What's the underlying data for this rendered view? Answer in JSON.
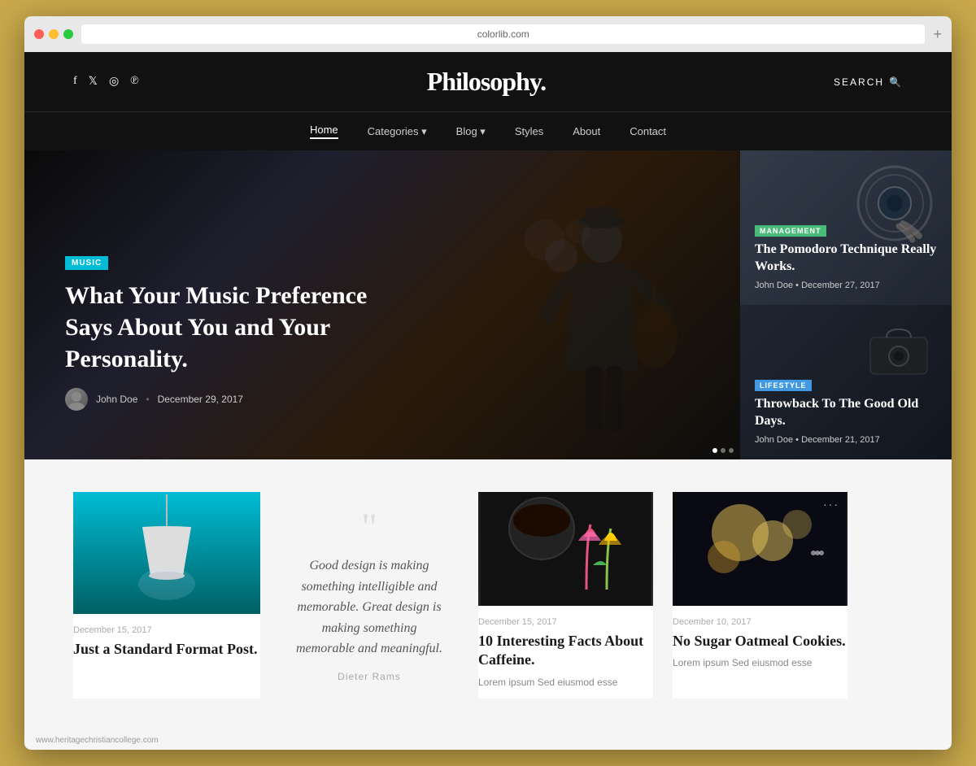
{
  "browser": {
    "url": "colorlib.com",
    "plus_button": "+"
  },
  "header": {
    "logo": "Philosophy.",
    "search_label": "SEARCH",
    "social": [
      "f",
      "𝕏",
      "◉",
      "℗"
    ]
  },
  "nav": {
    "items": [
      {
        "label": "Home",
        "active": true
      },
      {
        "label": "Categories",
        "has_dropdown": true
      },
      {
        "label": "Blog",
        "has_dropdown": true
      },
      {
        "label": "Styles",
        "has_dropdown": false
      },
      {
        "label": "About",
        "has_dropdown": false
      },
      {
        "label": "Contact",
        "has_dropdown": false
      }
    ]
  },
  "hero": {
    "tag": "MUSIC",
    "title": "What Your Music Preference Says About You and Your Personality.",
    "author": "John Doe",
    "date": "December 29, 2017"
  },
  "sidebar_cards": [
    {
      "tag": "MANAGEMENT",
      "tag_color": "green",
      "title": "The Pomodoro Technique Really Works.",
      "author": "John Doe",
      "date": "December 27, 2017"
    },
    {
      "tag": "LIFESTYLE",
      "tag_color": "teal",
      "title": "Throwback To The Good Old Days.",
      "author": "John Doe",
      "date": "December 21, 2017"
    }
  ],
  "posts": [
    {
      "type": "lamp",
      "date": "December 15, 2017",
      "title": "Just a Standard Format Post.",
      "excerpt": ""
    },
    {
      "type": "quote",
      "quote": "Good design is making something intelligible and memorable. Great design is making something memorable and meaningful.",
      "author": "Dieter Rams"
    },
    {
      "type": "coffee",
      "date": "December 15, 2017",
      "title": "10 Interesting Facts About Caffeine.",
      "excerpt": "Lorem ipsum Sed eiusmod esse"
    },
    {
      "type": "cookies",
      "date": "December 10, 2017",
      "title": "No Sugar Oatmeal Cookies.",
      "excerpt": "Lorem ipsum Sed eiusmod esse"
    }
  ],
  "footer_url": "www.heritagechristiancollege.com"
}
